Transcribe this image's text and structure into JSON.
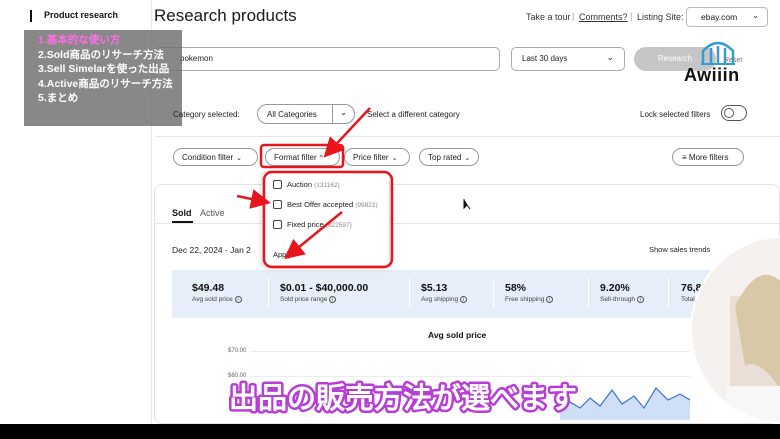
{
  "sidebar": {
    "label": "Product research"
  },
  "toc": {
    "items": [
      {
        "label": "1.基本的な使い方",
        "active": true
      },
      {
        "label": "2.Sold商品のリサーチ方法",
        "active": false
      },
      {
        "label": "3.Sell Simelarを使った出品",
        "active": false
      },
      {
        "label": "4.Active商品のリサーチ方法",
        "active": false
      },
      {
        "label": "5.まとめ",
        "active": false
      }
    ]
  },
  "header": {
    "title": "Research products",
    "take_tour": "Take a tour",
    "comments": "Comments?",
    "listing_site_label": "Listing Site:",
    "listing_site_value": "ebay.com"
  },
  "search": {
    "query": "pokemon",
    "date_range": "Last 30 days",
    "research_button": "Research",
    "reset": "Reset"
  },
  "logo": {
    "text": "Awiiin"
  },
  "category": {
    "label": "Category selected:",
    "value": "All Categories",
    "different": "Select a different category",
    "lock_label": "Lock selected filters"
  },
  "filters": {
    "condition": "Condition filter",
    "format": "Format filter",
    "price": "Price filter",
    "top_rated": "Top rated",
    "more": "More filters"
  },
  "format_dropdown": {
    "options": [
      {
        "label": "Auction",
        "count": "(131162)"
      },
      {
        "label": "Best Offer accepted",
        "count": "(99822)"
      },
      {
        "label": "Fixed price",
        "count": "(822597)"
      }
    ],
    "apply": "Apply"
  },
  "tabs": {
    "sold": "Sold",
    "active": "Active"
  },
  "results": {
    "date_range": "Dec 22, 2024 - Jan 2",
    "show_trends": "Show sales trends"
  },
  "stats": [
    {
      "value": "$49.48",
      "label": "Avg sold price"
    },
    {
      "value": "$0.01 - $40,000.00",
      "label": "Sold price range"
    },
    {
      "value": "$5.13",
      "label": "Avg shipping"
    },
    {
      "value": "58%",
      "label": "Free shipping"
    },
    {
      "value": "9.20%",
      "label": "Sell-through"
    },
    {
      "value": "76,8",
      "label": "Total"
    }
  ],
  "chart": {
    "title": "Avg sold price",
    "y_ticks": [
      "$70.00",
      "$60.00"
    ]
  },
  "caption": "出品の販売方法が選べます",
  "colors": {
    "annotation_red": "#e8161c",
    "caption_purple": "#b83dd6",
    "toc_active": "#ff6ee6"
  }
}
